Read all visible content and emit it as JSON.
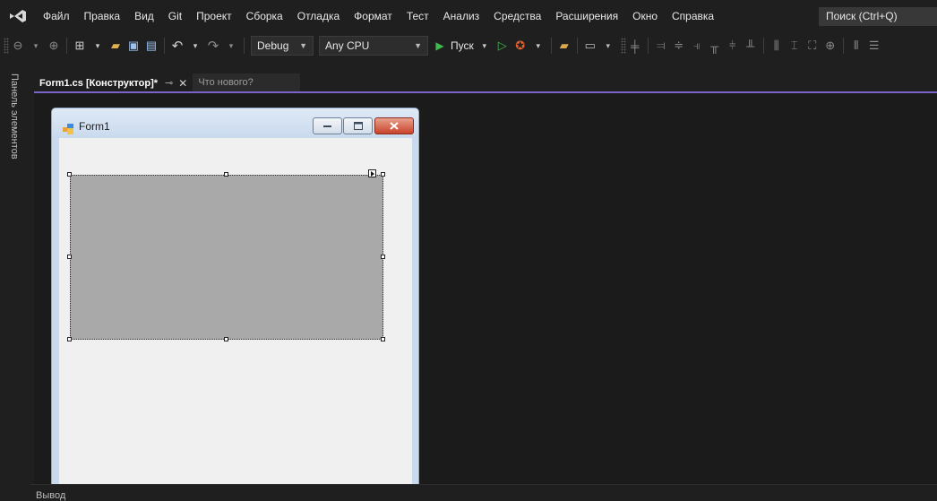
{
  "menu": {
    "items": [
      "Файл",
      "Правка",
      "Вид",
      "Git",
      "Проект",
      "Сборка",
      "Отладка",
      "Формат",
      "Тест",
      "Анализ",
      "Средства",
      "Расширения",
      "Окно",
      "Справка"
    ],
    "search_label": "Поиск (Ctrl+Q)"
  },
  "toolbar": {
    "configuration": "Debug",
    "platform": "Any CPU",
    "run_label": "Пуск"
  },
  "side_panel": {
    "toolbox_label": "Панель элементов"
  },
  "tabs": [
    {
      "label": "Form1.cs [Конструктор]*",
      "active": true
    },
    {
      "label": "Что нового?",
      "active": false
    }
  ],
  "designer": {
    "form_title": "Form1"
  },
  "output": {
    "label": "Вывод"
  },
  "colors": {
    "accent": "#7a64c9",
    "ide_background": "#1f1f1f",
    "run_green": "#3fb950",
    "panel_gray": "#a9a9a9"
  }
}
